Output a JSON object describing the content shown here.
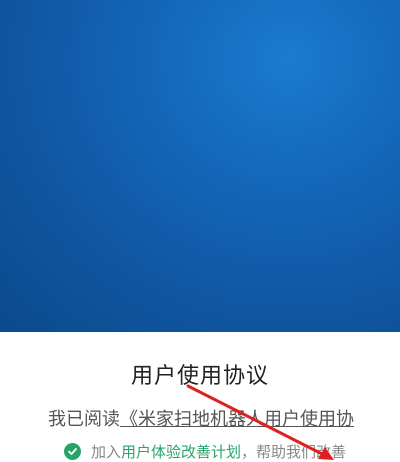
{
  "colors": {
    "hero_blue": "#1465b8",
    "accent_green": "#2aa36b",
    "annotation_red": "#e02020"
  },
  "dialog": {
    "title": "用户使用协议",
    "agreement_prefix": "我已阅读",
    "agreement_link": "《米家扫地机器人用户使用协",
    "plan_prefix": "加入",
    "plan_link": "用户体验改善计划",
    "plan_suffix": "，帮助我们改善"
  },
  "icons": {
    "plan_check": "check-circle-icon",
    "annotation": "red-arrow"
  }
}
